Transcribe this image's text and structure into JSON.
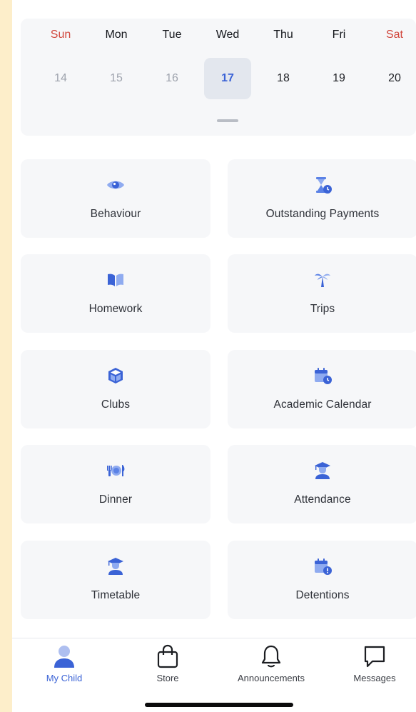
{
  "calendar": {
    "days": [
      {
        "name": "Sun",
        "num": "14",
        "state": "past",
        "weekend": true
      },
      {
        "name": "Mon",
        "num": "15",
        "state": "past",
        "weekend": false
      },
      {
        "name": "Tue",
        "num": "16",
        "state": "past",
        "weekend": false
      },
      {
        "name": "Wed",
        "num": "17",
        "state": "selected",
        "weekend": false
      },
      {
        "name": "Thu",
        "num": "18",
        "state": "future",
        "weekend": false
      },
      {
        "name": "Fri",
        "num": "19",
        "state": "future",
        "weekend": false
      },
      {
        "name": "Sat",
        "num": "20",
        "state": "future",
        "weekend": true
      }
    ]
  },
  "features": [
    {
      "label": "Behaviour",
      "icon": "eye-icon"
    },
    {
      "label": "Outstanding Payments",
      "icon": "hourglass-clock-icon"
    },
    {
      "label": "Homework",
      "icon": "book-icon"
    },
    {
      "label": "Trips",
      "icon": "palm-tree-icon"
    },
    {
      "label": "Clubs",
      "icon": "cube-icon"
    },
    {
      "label": "Academic Calendar",
      "icon": "calendar-clock-icon"
    },
    {
      "label": "Dinner",
      "icon": "plate-cutlery-icon"
    },
    {
      "label": "Attendance",
      "icon": "graduate-icon"
    },
    {
      "label": "Timetable",
      "icon": "graduate-icon"
    },
    {
      "label": "Detentions",
      "icon": "calendar-alert-icon"
    }
  ],
  "tabbar": {
    "tabs": [
      {
        "label": "My Child",
        "icon": "person-icon",
        "active": true
      },
      {
        "label": "Store",
        "icon": "shopping-bag-icon",
        "active": false
      },
      {
        "label": "Announcements",
        "icon": "bell-icon",
        "active": false
      },
      {
        "label": "Messages",
        "icon": "chat-bubble-icon",
        "active": false
      }
    ]
  },
  "colors": {
    "accent": "#3b63d6",
    "icon_blue": "#5b82e6",
    "weekend": "#d1473d",
    "tile_bg": "#f6f7f9",
    "outer_bg": "#fdeeca"
  }
}
